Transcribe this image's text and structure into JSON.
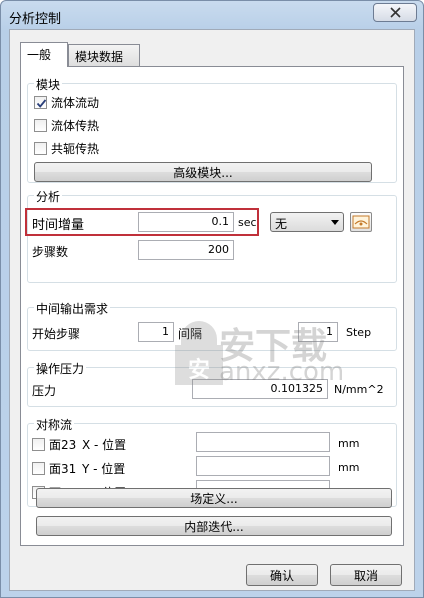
{
  "window": {
    "title": "分析控制"
  },
  "tabs": [
    {
      "label": "一般"
    },
    {
      "label": "模块数据"
    }
  ],
  "modules": {
    "label": "模块",
    "fluid_flow": {
      "label": "流体流动",
      "checked": true
    },
    "fluid_heat": {
      "label": "流体传热",
      "checked": false
    },
    "conjugate_heat": {
      "label": "共轭传热",
      "checked": false
    },
    "advanced_button": "高级模块..."
  },
  "analysis": {
    "label": "分析",
    "time_step_label": "时间增量",
    "time_step_value": "0.1",
    "time_step_unit": "sec",
    "mode_select": "无",
    "steps_label": "步骤数",
    "steps_value": "200"
  },
  "intermediate": {
    "label": "中间输出需求",
    "start_label": "开始步骤",
    "start_value": "1",
    "interval_label": "间隔",
    "interval_value": "1",
    "interval_unit": "Step"
  },
  "pressure": {
    "label": "操作压力",
    "pressure_label": "压力",
    "pressure_value": "0.101325",
    "pressure_unit": "N/mm^2"
  },
  "symmetry": {
    "label": "对称流",
    "rows": [
      {
        "plane": "面23",
        "axis_label": "X - 位置",
        "value": "",
        "unit": "mm"
      },
      {
        "plane": "面31",
        "axis_label": "Y - 位置",
        "value": "",
        "unit": "mm"
      },
      {
        "plane": "面12",
        "axis_label": "Z - 位置",
        "value": "",
        "unit": "mm"
      }
    ]
  },
  "buttons": {
    "field_definition": "场定义...",
    "internal_iteration": "内部迭代...",
    "ok": "确认",
    "cancel": "取消"
  },
  "watermark": {
    "text_cn": "安下载",
    "text_en": "anxz.com"
  }
}
